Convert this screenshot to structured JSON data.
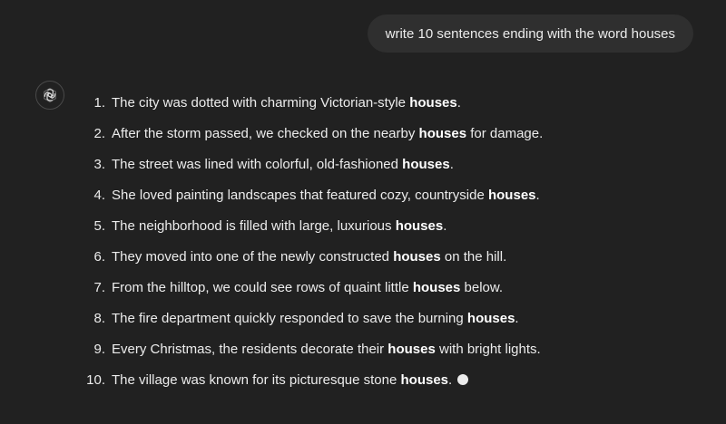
{
  "user_message": "write 10 sentences ending with the word houses",
  "assistant_icon": "openai-logo-icon",
  "answer_items": [
    {
      "number": "1.",
      "before": "The city was dotted with charming Victorian-style ",
      "bold": "houses",
      "after": "."
    },
    {
      "number": "2.",
      "before": "After the storm passed, we checked on the nearby ",
      "bold": "houses",
      "after": " for damage."
    },
    {
      "number": "3.",
      "before": "The street was lined with colorful, old-fashioned ",
      "bold": "houses",
      "after": "."
    },
    {
      "number": "4.",
      "before": "She loved painting landscapes that featured cozy, countryside ",
      "bold": "houses",
      "after": "."
    },
    {
      "number": "5.",
      "before": "The neighborhood is filled with large, luxurious ",
      "bold": "houses",
      "after": "."
    },
    {
      "number": "6.",
      "before": "They moved into one of the newly constructed ",
      "bold": "houses",
      "after": " on the hill."
    },
    {
      "number": "7.",
      "before": "From the hilltop, we could see rows of quaint little ",
      "bold": "houses",
      "after": " below."
    },
    {
      "number": "8.",
      "before": "The fire department quickly responded to save the burning ",
      "bold": "houses",
      "after": "."
    },
    {
      "number": "9.",
      "before": "Every Christmas, the residents decorate their ",
      "bold": "houses",
      "after": " with bright lights."
    },
    {
      "number": "10.",
      "before": "The village was known for its picturesque stone ",
      "bold": "houses",
      "after": "."
    }
  ],
  "colors": {
    "background": "#212121",
    "user_bubble": "#2f2f2f",
    "text": "#ececec"
  }
}
